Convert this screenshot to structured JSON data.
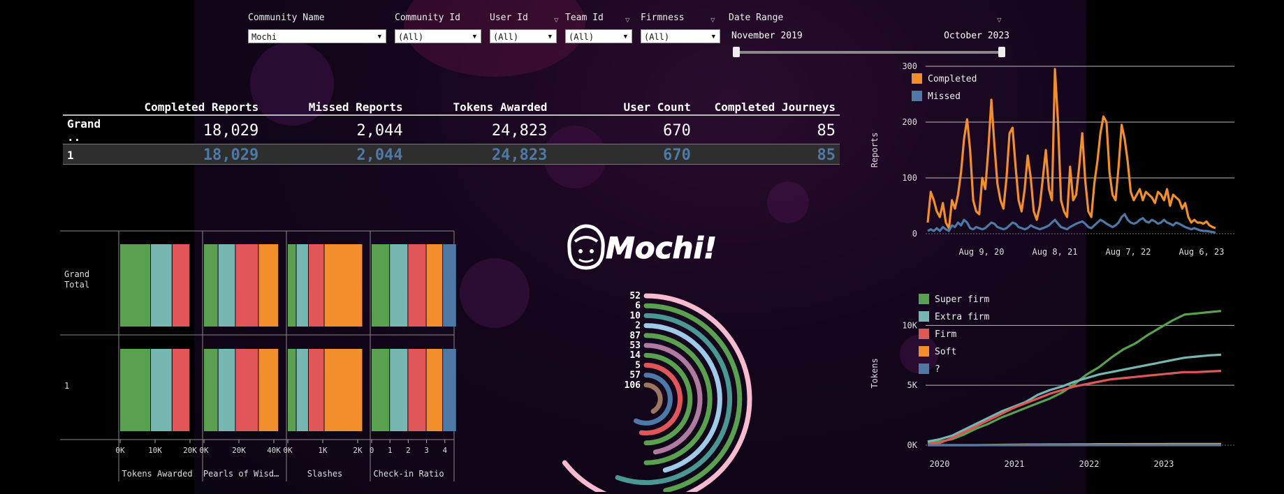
{
  "filters": [
    {
      "label": "Community Name",
      "value": "Mochi"
    },
    {
      "label": "Community Id",
      "value": "(All)"
    },
    {
      "label": "User Id",
      "value": "(All)"
    },
    {
      "label": "Team Id",
      "value": "(All)"
    },
    {
      "label": "Firmness",
      "value": "(All)"
    }
  ],
  "date_range": {
    "label": "Date Range",
    "start": "November 2019",
    "end": "October 2023"
  },
  "kpi_table": {
    "headers": [
      "Completed Reports",
      "Missed Reports",
      "Tokens Awarded",
      "User Count",
      "Completed Journeys"
    ],
    "rows": [
      {
        "label": "Grand ..",
        "values": [
          "18,029",
          "2,044",
          "24,823",
          "670",
          "85"
        ]
      },
      {
        "label": "1",
        "values": [
          "18,029",
          "2,044",
          "24,823",
          "670",
          "85"
        ]
      }
    ]
  },
  "logo_text": "Mochi!",
  "colors": {
    "green": "#59a14f",
    "teal": "#76b7b2",
    "red": "#e15759",
    "orange": "#f28e2b",
    "blue": "#4e79a7",
    "pink": "#f8bbd0"
  },
  "stacked_panel": {
    "row_labels": [
      "Grand Total",
      "1"
    ],
    "columns": [
      {
        "title": "Tokens Awarded",
        "ticks": [
          "0K",
          "10K",
          "20K"
        ],
        "max": 25000,
        "segments": [
          {
            "color": "green",
            "value": 10000
          },
          {
            "color": "teal",
            "value": 7000
          },
          {
            "color": "red",
            "value": 5800
          }
        ]
      },
      {
        "title": "Pearls of Wisd…",
        "ticks": [
          "0K",
          "20K",
          "40K"
        ],
        "max": 40000,
        "segments": [
          {
            "color": "green",
            "value": 7500
          },
          {
            "color": "teal",
            "value": 9000
          },
          {
            "color": "red",
            "value": 12000
          },
          {
            "color": "orange",
            "value": 10500
          }
        ]
      },
      {
        "title": "Slashes",
        "ticks": [
          "0K",
          "1K",
          "2K"
        ],
        "max": 2200,
        "segments": [
          {
            "color": "green",
            "value": 250
          },
          {
            "color": "teal",
            "value": 350
          },
          {
            "color": "red",
            "value": 450
          },
          {
            "color": "orange",
            "value": 1100
          }
        ]
      },
      {
        "title": "Check-in Ratio",
        "ticks": [
          "0",
          "1",
          "2",
          "3",
          "4"
        ],
        "max": 4.2,
        "segments": [
          {
            "color": "green",
            "value": 1.0
          },
          {
            "color": "teal",
            "value": 1.0
          },
          {
            "color": "red",
            "value": 1.0
          },
          {
            "color": "orange",
            "value": 0.9
          },
          {
            "color": "blue",
            "value": 0.75
          }
        ]
      }
    ]
  },
  "radial_chart": {
    "values": [
      "52",
      "6",
      "10",
      "2",
      "87",
      "53",
      "14",
      "5",
      "57",
      "106"
    ],
    "colors": [
      "pink",
      "green",
      "teal",
      "lightblue",
      "green",
      "mauve",
      "green",
      "red",
      "blue",
      "brown"
    ],
    "colors_hex": {
      "pink": "#f8bbd0",
      "green": "#59a14f",
      "teal": "#499894",
      "lightblue": "#a0cbe8",
      "mauve": "#b07aa1",
      "red": "#e15759",
      "blue": "#4e79a7",
      "brown": "#9d7660",
      "lightgreen": "#8cd17d"
    }
  },
  "chart_data": [
    {
      "type": "line",
      "ylabel": "Reports",
      "x_ticks": [
        "Aug 9, 20",
        "Aug 8, 21",
        "Aug 7, 22",
        "Aug 6, 23"
      ],
      "ylim": [
        0,
        300
      ],
      "y_ticks": [
        "0",
        "100",
        "200",
        "300"
      ],
      "legend": "top-left",
      "series": [
        {
          "name": "Completed",
          "color": "#f28e2b",
          "values": [
            20,
            75,
            60,
            40,
            30,
            55,
            20,
            10,
            60,
            45,
            70,
            110,
            170,
            205,
            150,
            60,
            40,
            35,
            100,
            80,
            150,
            240,
            160,
            90,
            60,
            45,
            100,
            180,
            190,
            120,
            60,
            40,
            80,
            140,
            100,
            40,
            25,
            50,
            100,
            150,
            80,
            60,
            295,
            200,
            60,
            40,
            30,
            120,
            60,
            70,
            120,
            180,
            95,
            40,
            30,
            90,
            130,
            180,
            210,
            200,
            110,
            70,
            60,
            120,
            195,
            170,
            130,
            75,
            60,
            70,
            80,
            60,
            75,
            70,
            65,
            55,
            75,
            70,
            60,
            80,
            50,
            70,
            65,
            60,
            45,
            55,
            30,
            20,
            25,
            20,
            20,
            18,
            22,
            15,
            12,
            10
          ]
        },
        {
          "name": "Missed",
          "color": "#4e79a7",
          "values": [
            5,
            8,
            5,
            10,
            5,
            12,
            8,
            5,
            15,
            12,
            20,
            15,
            25,
            20,
            10,
            8,
            12,
            10,
            8,
            10,
            15,
            20,
            18,
            12,
            10,
            8,
            10,
            15,
            20,
            18,
            12,
            10,
            8,
            10,
            15,
            12,
            10,
            8,
            10,
            12,
            15,
            20,
            25,
            18,
            12,
            10,
            8,
            12,
            15,
            18,
            20,
            22,
            18,
            12,
            10,
            15,
            20,
            25,
            22,
            18,
            15,
            12,
            15,
            20,
            30,
            35,
            25,
            20,
            18,
            20,
            25,
            28,
            22,
            20,
            25,
            22,
            18,
            20,
            25,
            20,
            18,
            15,
            20,
            18,
            15,
            12,
            10,
            8,
            10,
            8,
            6,
            5,
            5,
            4,
            3,
            2
          ]
        }
      ]
    },
    {
      "type": "line",
      "ylabel": "Tokens",
      "x_ticks": [
        "2020",
        "2021",
        "2022",
        "2023"
      ],
      "ylim": [
        0,
        12000
      ],
      "y_ticks": [
        "0K",
        "5K",
        "10K"
      ],
      "legend": "top-left",
      "series": [
        {
          "name": "Super firm",
          "color": "#59a14f",
          "x": [
            0,
            4,
            8,
            12,
            16,
            20,
            24,
            28,
            32,
            36,
            40,
            44,
            48,
            52,
            56,
            60,
            64,
            68,
            72,
            76,
            80,
            84,
            88,
            92,
            96
          ],
          "values": [
            200,
            300,
            500,
            900,
            1400,
            1800,
            2300,
            2700,
            3100,
            3500,
            3900,
            4400,
            5100,
            5900,
            6500,
            7300,
            8000,
            8500,
            9200,
            9800,
            10400,
            10900,
            11000,
            11100,
            11200
          ]
        },
        {
          "name": "Extra firm",
          "color": "#76b7b2",
          "x": [
            0,
            4,
            8,
            12,
            16,
            20,
            24,
            28,
            32,
            36,
            40,
            44,
            48,
            52,
            56,
            60,
            64,
            68,
            72,
            76,
            80,
            84,
            88,
            92,
            96
          ],
          "values": [
            300,
            500,
            800,
            1300,
            1800,
            2300,
            2800,
            3200,
            3600,
            4200,
            4600,
            4900,
            5300,
            5600,
            5900,
            6100,
            6300,
            6500,
            6700,
            6900,
            7100,
            7300,
            7400,
            7500,
            7550
          ]
        },
        {
          "name": "Firm",
          "color": "#e15759",
          "x": [
            0,
            4,
            8,
            12,
            16,
            20,
            24,
            28,
            32,
            36,
            40,
            44,
            48,
            52,
            56,
            60,
            64,
            68,
            72,
            76,
            80,
            84,
            88,
            92,
            96
          ],
          "values": [
            100,
            200,
            600,
            1100,
            1600,
            2100,
            2600,
            3100,
            3500,
            3900,
            4300,
            4600,
            4900,
            5100,
            5300,
            5500,
            5600,
            5700,
            5800,
            5900,
            6000,
            6100,
            6100,
            6150,
            6200
          ]
        },
        {
          "name": "Soft",
          "color": "#f28e2b",
          "x": [
            0,
            4,
            8,
            12,
            16,
            20,
            24,
            28,
            32,
            36,
            40,
            44,
            48,
            52,
            56,
            60,
            64,
            68,
            72,
            76,
            80,
            84,
            88,
            92,
            96
          ],
          "values": [
            0,
            0,
            0,
            0,
            0,
            20,
            30,
            40,
            50,
            50,
            60,
            60,
            70,
            70,
            80,
            80,
            80,
            90,
            90,
            90,
            100,
            100,
            100,
            100,
            100
          ]
        },
        {
          "name": "?",
          "color": "#4e79a7",
          "x": [
            0,
            4,
            8,
            12,
            16,
            20,
            24,
            28,
            32,
            36,
            40,
            44,
            48,
            52,
            56,
            60,
            64,
            68,
            72,
            76,
            80,
            84,
            88,
            92,
            96
          ],
          "values": [
            0,
            0,
            0,
            0,
            0,
            0,
            0,
            0,
            0,
            0,
            0,
            0,
            0,
            0,
            0,
            0,
            0,
            0,
            0,
            0,
            0,
            0,
            0,
            0,
            0
          ]
        }
      ]
    }
  ]
}
